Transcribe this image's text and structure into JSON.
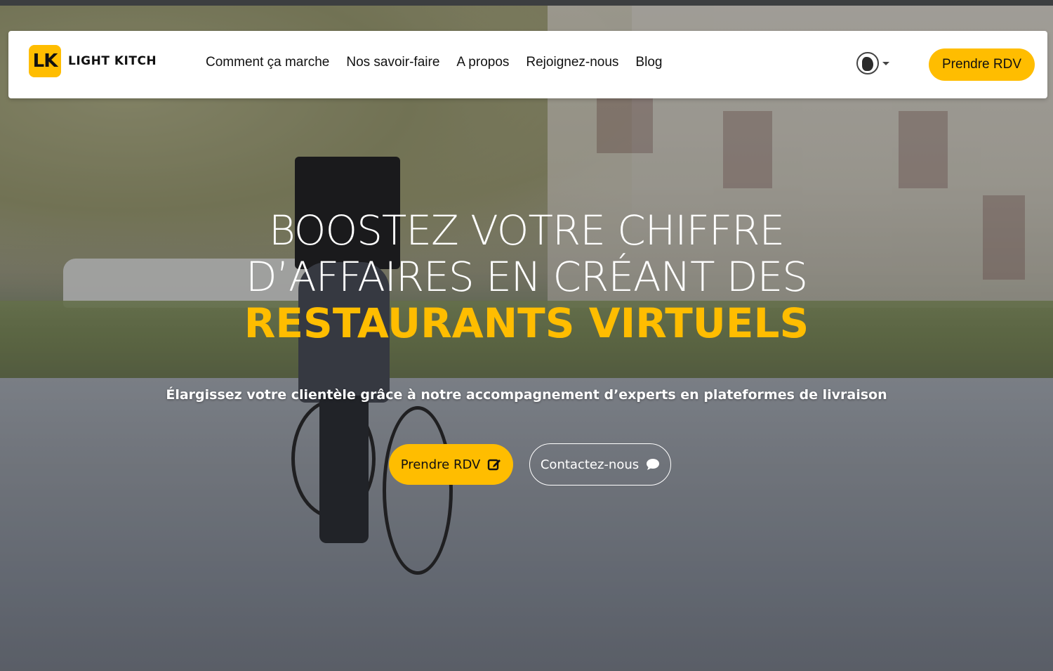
{
  "brand": {
    "mark": "LK",
    "name": "LIGHT KITCH",
    "accent_color": "#ffbd00"
  },
  "nav": {
    "items": [
      {
        "label": "Comment ça marche"
      },
      {
        "label": "Nos savoir-faire"
      },
      {
        "label": "A propos"
      },
      {
        "label": "Rejoignez-nous"
      },
      {
        "label": "Blog"
      }
    ],
    "language_icon": "globe-icon",
    "cta_label": "Prendre RDV"
  },
  "hero": {
    "headline_line1": "BOOSTEZ VOTRE CHIFFRE",
    "headline_line2": "D’AFFAIRES EN CRÉANT DES",
    "headline_accent": "RESTAURANTS VIRTUELS",
    "subtitle": "Élargissez votre clientèle grâce à notre accompagnement d’experts en plateformes de livraison",
    "primary_button": {
      "label": "Prendre RDV",
      "icon": "edit-icon"
    },
    "secondary_button": {
      "label": "Contactez-nous",
      "icon": "chat-bubble-icon"
    }
  }
}
